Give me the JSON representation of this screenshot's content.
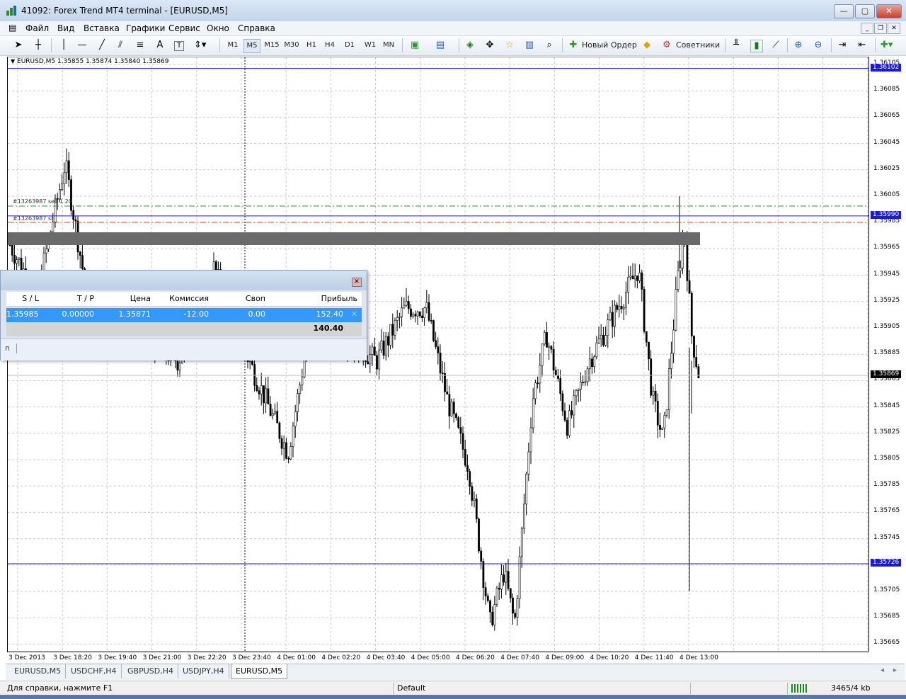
{
  "window": {
    "title": "41092: Forex Trend MT4 terminal - [EURUSD,M5]",
    "buttons": {
      "minimize": "—",
      "maximize": "▢",
      "close": "✕"
    }
  },
  "menu": [
    "Файл",
    "Вид",
    "Вставка",
    "Графики",
    "Сервис",
    "Окно",
    "Справка"
  ],
  "toolbar": {
    "timeframes": [
      "M1",
      "M5",
      "M15",
      "M30",
      "H1",
      "H4",
      "D1",
      "W1",
      "MN"
    ],
    "selected_timeframe": "M5",
    "new_order_label": "Новый Ордер",
    "experts_label": "Советники",
    "text_tool": "A",
    "text_label_tool": "T"
  },
  "chart": {
    "symbol_info": "EURUSD,M5  1.35855 1.35874 1.35840 1.35869",
    "order_labels": [
      "#13263987 sell 1.20",
      "#13263987 sl"
    ],
    "price_ticks": [
      "1.36105",
      "1.36085",
      "1.36065",
      "1.36045",
      "1.36025",
      "1.36005",
      "1.35985",
      "1.35965",
      "1.35945",
      "1.35925",
      "1.35905",
      "1.35885",
      "1.35865",
      "1.35845",
      "1.35825",
      "1.35805",
      "1.35785",
      "1.35765",
      "1.35745",
      "1.35705",
      "1.35685",
      "1.35665"
    ],
    "price_tags": {
      "top_line": "1.36102",
      "sl_line": "1.35990",
      "bid": "1.35869",
      "bottom_line": "1.35726"
    },
    "time_ticks": [
      "3 Dec 2013",
      "3 Dec 18:20",
      "3 Dec 19:40",
      "3 Dec 21:00",
      "3 Dec 22:20",
      "3 Dec 23:40",
      "4 Dec 01:00",
      "4 Dec 02:20",
      "4 Dec 03:40",
      "4 Dec 05:00",
      "4 Dec 06:20",
      "4 Dec 07:40",
      "4 Dec 09:00",
      "4 Dec 10:20",
      "4 Dec 11:40",
      "4 Dec 13:00"
    ],
    "colors": {
      "hline": "#1a1ad6",
      "tp_line": "#2f9a2f",
      "sl_line": "#d9541c",
      "zone": "#6a6a6a",
      "price_tag_bg": "#1a1ad6",
      "bid_tag_bg": "#000000"
    }
  },
  "terminal": {
    "headers": [
      "S / L",
      "T / P",
      "Цена",
      "Комиссия",
      "Своп",
      "Прибыль"
    ],
    "row": {
      "sl": "1.35985",
      "tp": "0.00000",
      "price": "1.35871",
      "commission": "-12.00",
      "swap": "0.00",
      "profit": "152.40"
    },
    "total": "140.40",
    "close_icon": "✕",
    "bottom_fragment": "n"
  },
  "tabs": [
    "EURUSD,M5",
    "USDCHF,H4",
    "GBPUSD,H4",
    "USDJPY,H4",
    "EURUSD,M5"
  ],
  "active_tab": "EURUSD,M5",
  "status": {
    "help": "Для справки, нажмите F1",
    "profile": "Default",
    "traffic": "3465/4 kb"
  }
}
